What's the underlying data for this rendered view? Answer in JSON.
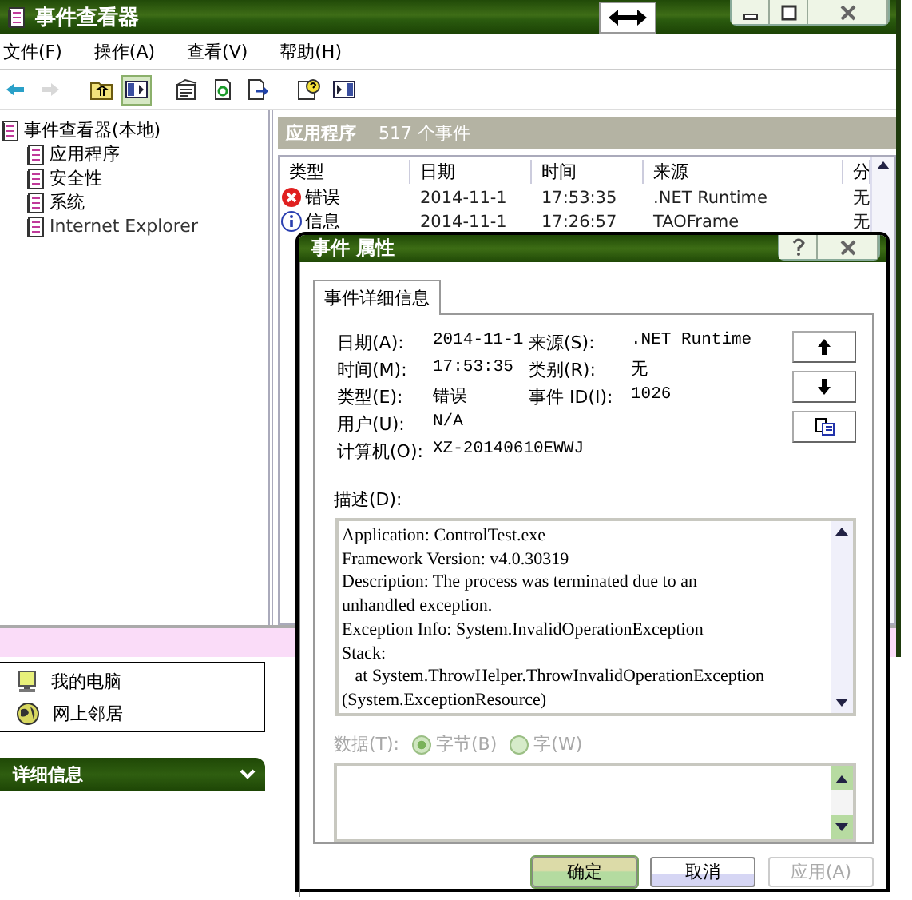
{
  "main_window": {
    "title": "事件查看器",
    "menu": [
      "文件(F)",
      "操作(A)",
      "查看(V)",
      "帮助(H)"
    ],
    "toolbar": [
      {
        "kind": "back",
        "disabled": false,
        "pressed": false
      },
      {
        "kind": "forward",
        "disabled": true,
        "pressed": false
      },
      {
        "kind": "up",
        "disabled": false,
        "pressed": false
      },
      {
        "kind": "tree",
        "disabled": false,
        "pressed": true
      },
      {
        "kind": "properties",
        "disabled": false,
        "pressed": false
      },
      {
        "kind": "refresh",
        "disabled": false,
        "pressed": false
      },
      {
        "kind": "export",
        "disabled": false,
        "pressed": false
      },
      {
        "kind": "help",
        "disabled": false,
        "pressed": false
      },
      {
        "kind": "pane",
        "disabled": false,
        "pressed": false
      }
    ],
    "tree": {
      "label": "事件查看器(本地)",
      "children": [
        {
          "label": "应用程序"
        },
        {
          "label": "安全性"
        },
        {
          "label": "系统"
        },
        {
          "label": "Internet Explorer"
        }
      ]
    },
    "pane": {
      "title": "应用程序",
      "count": "517 个事件",
      "columns": [
        "类型",
        "日期",
        "时间",
        "来源",
        "分"
      ],
      "rows": [
        {
          "kind": "error",
          "type": "错误",
          "date": "2014-11-1",
          "time": "17:53:35",
          "source": ".NET Runtime",
          "category": "无"
        },
        {
          "kind": "info",
          "type": "信息",
          "date": "2014-11-1",
          "time": "17:26:57",
          "source": "TAOFrame",
          "category": "无"
        }
      ]
    }
  },
  "task_pane": {
    "places": [
      {
        "kind": "computer",
        "label": "我的电脑"
      },
      {
        "kind": "network",
        "label": "网上邻居"
      }
    ],
    "details_title": "详细信息"
  },
  "dialog": {
    "title": "事件 属性",
    "tab": "事件详细信息",
    "left_fields": [
      {
        "label": "日期(A):",
        "value": "2014-11-1"
      },
      {
        "label": "时间(M):",
        "value": "17:53:35"
      },
      {
        "label": "类型(E):",
        "value": "错误"
      },
      {
        "label": "用户(U):",
        "value": "N/A"
      },
      {
        "label": "计算机(O):",
        "value": "XZ-20140610EWWJ"
      }
    ],
    "right_fields": [
      {
        "label": "来源(S):",
        "value": ".NET Runtime"
      },
      {
        "label": "类别(R):",
        "value": "无"
      },
      {
        "label": "事件 ID(I):",
        "value": "1026"
      }
    ],
    "description_label": "描述(D):",
    "description_lines": [
      "Application: ControlTest.exe",
      "Framework Version: v4.0.30319",
      "Description: The process was terminated due to an",
      "unhandled exception.",
      "Exception Info: System.InvalidOperationException",
      "Stack:",
      "   at System.ThrowHelper.ThrowInvalidOperationException",
      "(System.ExceptionResource)"
    ],
    "data_label": "数据(T):",
    "data_formats": [
      {
        "label": "字节(B)",
        "selected": true
      },
      {
        "label": "字(W)",
        "selected": false
      }
    ],
    "buttons": [
      {
        "label": "确定",
        "kind": "default",
        "disabled": false
      },
      {
        "label": "取消",
        "kind": "normal",
        "disabled": false
      },
      {
        "label": "应用(A)",
        "kind": "normal",
        "disabled": true
      }
    ]
  }
}
